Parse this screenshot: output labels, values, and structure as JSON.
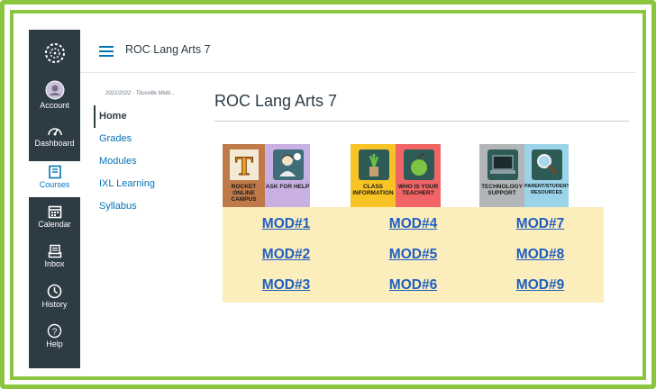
{
  "global_nav": {
    "items": [
      {
        "label": "Account",
        "icon": "avatar-icon"
      },
      {
        "label": "Dashboard",
        "icon": "dashboard-icon"
      },
      {
        "label": "Courses",
        "icon": "book-icon"
      },
      {
        "label": "Calendar",
        "icon": "calendar-icon"
      },
      {
        "label": "Inbox",
        "icon": "inbox-icon"
      },
      {
        "label": "History",
        "icon": "clock-icon"
      },
      {
        "label": "Help",
        "icon": "help-icon"
      }
    ],
    "active": "Courses",
    "colors": {
      "bg": "#2d3b45",
      "active_text": "#0374b5"
    }
  },
  "header": {
    "course_title": "ROC Lang Arts 7"
  },
  "course_nav": {
    "term": "2021/2022 - Titusville Midd...",
    "items": [
      "Home",
      "Grades",
      "Modules",
      "IXL Learning",
      "Syllabus"
    ],
    "selected": "Home"
  },
  "main": {
    "title": "ROC Lang Arts 7",
    "tiles": [
      {
        "caption": "ROCKET ONLINE CAMPUS",
        "icon": "rocket-t-icon",
        "color": "#c07a4a"
      },
      {
        "caption": "ASK FOR HELP",
        "icon": "person-icon",
        "color": "#c9b0e3"
      },
      {
        "caption": "CLASS INFORMATION",
        "icon": "plant-icon",
        "color": "#f7c325"
      },
      {
        "caption": "WHO IS YOUR TEACHER?",
        "icon": "apple-icon",
        "color": "#f06466"
      },
      {
        "caption": "TECHNOLOGY SUPPORT",
        "icon": "laptop-icon",
        "color": "#b3b6b8"
      },
      {
        "caption": "PARENT/STUDENT RESOURCES",
        "icon": "magnifier-icon",
        "color": "#9bd3e8"
      }
    ],
    "modules": [
      "MOD#1",
      "MOD#4",
      "MOD#7",
      "MOD#2",
      "MOD#5",
      "MOD#8",
      "MOD#3",
      "MOD#6",
      "MOD#9"
    ],
    "modules_bg": "#fcedbd",
    "link_color": "#1f5fbf"
  },
  "frame_color": "#8cc63f"
}
